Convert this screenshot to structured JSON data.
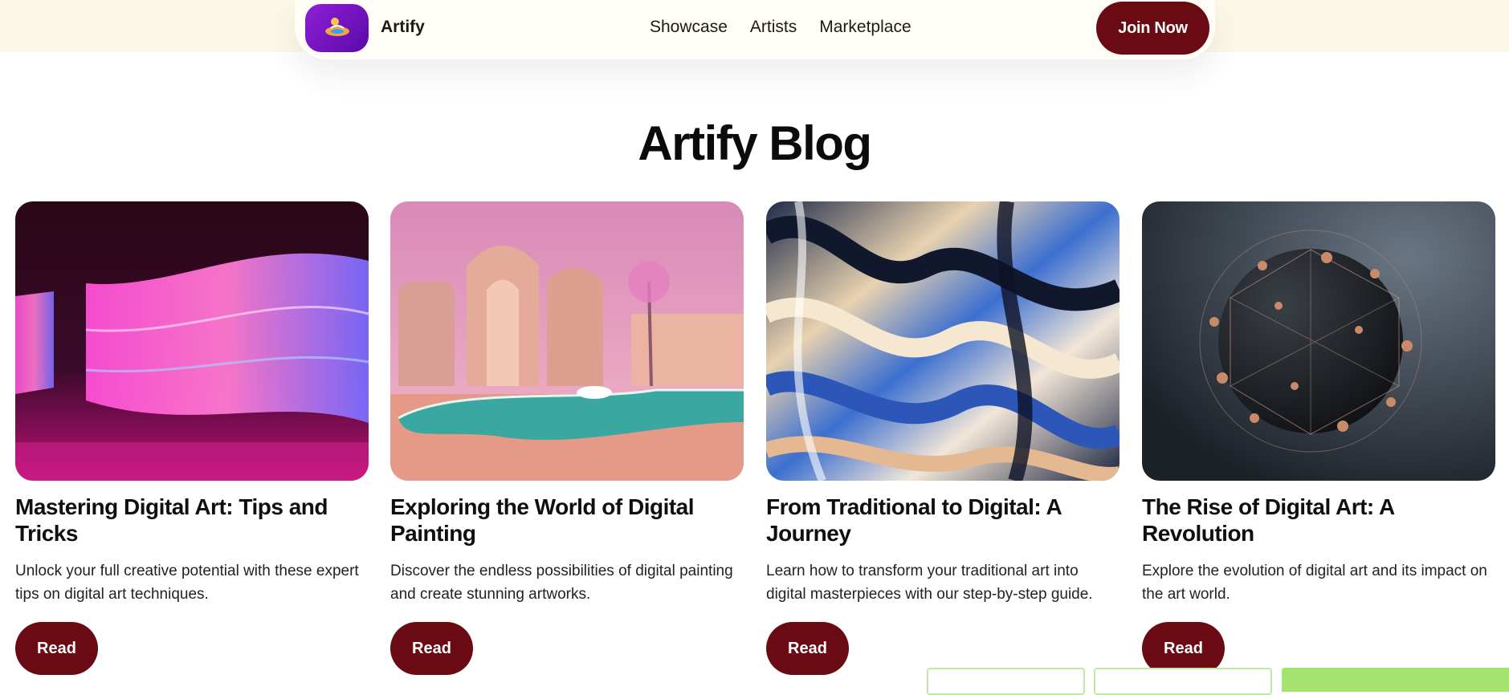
{
  "brand": {
    "name": "Artify"
  },
  "nav": {
    "links": [
      "Showcase",
      "Artists",
      "Marketplace"
    ],
    "cta": "Join Now"
  },
  "page": {
    "title": "Artify Blog"
  },
  "posts": [
    {
      "title": "Mastering Digital Art: Tips and Tricks",
      "description": "Unlock your full creative potential with these expert tips on digital art techniques.",
      "button": "Read"
    },
    {
      "title": "Exploring the World of Digital Painting",
      "description": "Discover the endless possibilities of digital painting and create stunning artworks.",
      "button": "Read"
    },
    {
      "title": "From Traditional to Digital: A Journey",
      "description": "Learn how to transform your traditional art into digital masterpieces with our step-by-step guide.",
      "button": "Read"
    },
    {
      "title": "The Rise of Digital Art: A Revolution",
      "description": "Explore the evolution of digital art and its impact on the art world.",
      "button": "Read"
    }
  ],
  "colors": {
    "accent": "#6a0a12",
    "logo_bg": "#7a14c8",
    "topband": "#fdf7e8",
    "peek_green": "#a4e36f"
  },
  "icons": {
    "logo": "artify-logo-icon"
  }
}
